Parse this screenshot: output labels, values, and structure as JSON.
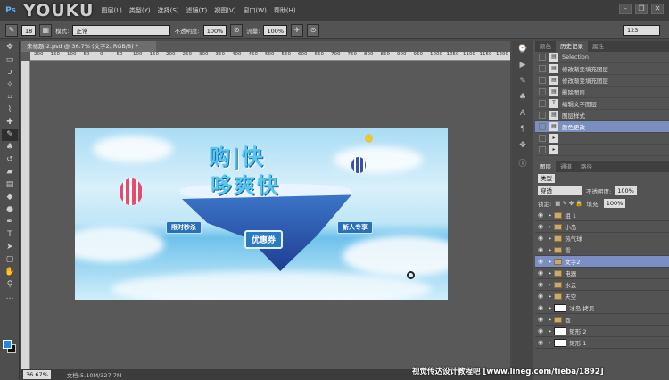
{
  "brand": {
    "logo": "Ps",
    "overlay": "YOUKU"
  },
  "menu": [
    "图层(L)",
    "类型(Y)",
    "选择(S)",
    "滤镜(T)",
    "视图(V)",
    "窗口(W)",
    "帮助(H)"
  ],
  "options": {
    "mode_label": "模式:",
    "mode_value": "正常",
    "opacity_label": "不透明度:",
    "opacity_value": "100%",
    "flow_label": "流量:",
    "flow_value": "100%",
    "brush_size": "18",
    "right_field": "123"
  },
  "document": {
    "tab_title": "未标题-2.psd @ 36.7% (文字2, RGB/8) *",
    "zoom": "36.67%",
    "info": "文档:5.10M/327.7M"
  },
  "ruler": [
    "200",
    "150",
    "100",
    "50",
    "0",
    "50",
    "100",
    "150",
    "200",
    "250",
    "300",
    "350",
    "400",
    "450",
    "500",
    "550",
    "600",
    "650",
    "700",
    "750",
    "800",
    "850",
    "900",
    "950",
    "1000",
    "1050",
    "1100",
    "1150",
    "1200"
  ],
  "banner": {
    "headline1": "购|快",
    "headline2": "哆爽快",
    "pill_left": "限时秒杀",
    "pill_center": "优惠券",
    "pill_right": "新人专享"
  },
  "history": {
    "tabs": [
      "颜色",
      "历史记录",
      "属性"
    ],
    "rows": [
      {
        "label": "Selection",
        "sel": false
      },
      {
        "label": "修改渐变填充图层",
        "sel": false
      },
      {
        "label": "修改渐变填充图层",
        "sel": false
      },
      {
        "label": "删除图层",
        "sel": false
      },
      {
        "label": "编辑文字图层",
        "sel": false
      },
      {
        "label": "图层样式",
        "sel": false
      },
      {
        "label": "颜色更改",
        "sel": true
      },
      {
        "label": "",
        "sel": false
      },
      {
        "label": "",
        "sel": false
      }
    ]
  },
  "layers": {
    "tabs": [
      "图层",
      "通道",
      "路径"
    ],
    "filter": "类型",
    "blend": "穿透",
    "opacity_label": "不透明度:",
    "opacity": "100%",
    "lock_label": "锁定:",
    "fill_label": "填充:",
    "fill": "100%",
    "rows": [
      {
        "name": "组 1",
        "type": "folder",
        "sel": false
      },
      {
        "name": "小岛",
        "type": "folder",
        "sel": false
      },
      {
        "name": "热气球",
        "type": "folder",
        "sel": false
      },
      {
        "name": "雪",
        "type": "folder",
        "sel": false
      },
      {
        "name": "文字2",
        "type": "folder",
        "sel": true
      },
      {
        "name": "电器",
        "type": "folder",
        "sel": false
      },
      {
        "name": "水云",
        "type": "folder",
        "sel": false
      },
      {
        "name": "天空",
        "type": "folder",
        "sel": false
      },
      {
        "name": "冰岛 拷贝",
        "type": "thumb",
        "sel": false
      },
      {
        "name": "面",
        "type": "folder",
        "sel": false
      },
      {
        "name": "矩形 2",
        "type": "thumb",
        "sel": false
      },
      {
        "name": "矩形 1",
        "type": "thumb",
        "sel": false
      }
    ]
  },
  "watermark": "视觉传达设计教程吧 [www.lineg.com/tieba/1892]",
  "colors": {
    "fg": "#1e88e5",
    "bg": "#111111"
  }
}
